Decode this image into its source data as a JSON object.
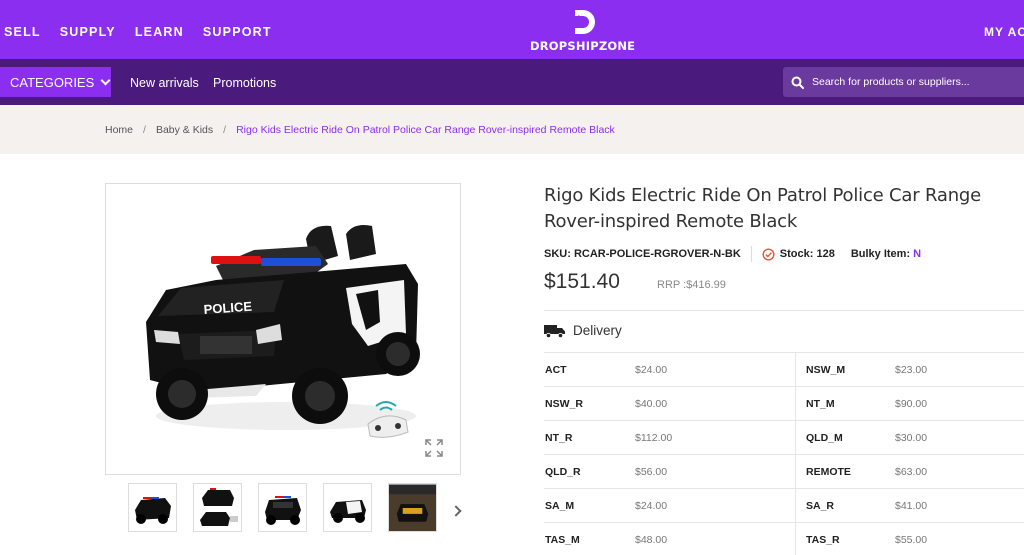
{
  "topnav": {
    "items": [
      "SELL",
      "SUPPLY",
      "LEARN",
      "SUPPORT"
    ],
    "logo_text": "DROPSHIPZONE",
    "account": "MY AC"
  },
  "navbar": {
    "categories": "CATEGORIES",
    "links": [
      "New arrivals",
      "Promotions"
    ],
    "search_placeholder": "Search for products or suppliers..."
  },
  "breadcrumb": {
    "items": [
      "Home",
      "Baby & Kids",
      "Rigo Kids Electric Ride On Patrol Police Car Range Rover-inspired Remote Black"
    ],
    "separator": "/"
  },
  "product": {
    "title": "Rigo Kids Electric Ride On Patrol Police Car Range Rover-inspired Remote Black",
    "sku_label": "SKU: RCAR-POLICE-RGROVER-N-BK",
    "stock_label": "Stock: 128",
    "bulky_label": "Bulky Item:",
    "bulky_value": "N",
    "price": "$151.40",
    "rrp": "RRP :$416.99",
    "car_text": "POLICE"
  },
  "delivery": {
    "heading": "Delivery",
    "rates": [
      {
        "left_region": "ACT",
        "left_price": "$24.00",
        "right_region": "NSW_M",
        "right_price": "$23.00"
      },
      {
        "left_region": "NSW_R",
        "left_price": "$40.00",
        "right_region": "NT_M",
        "right_price": "$90.00"
      },
      {
        "left_region": "NT_R",
        "left_price": "$112.00",
        "right_region": "QLD_M",
        "right_price": "$30.00"
      },
      {
        "left_region": "QLD_R",
        "left_price": "$56.00",
        "right_region": "REMOTE",
        "right_price": "$63.00"
      },
      {
        "left_region": "SA_M",
        "left_price": "$24.00",
        "right_region": "SA_R",
        "right_price": "$41.00"
      },
      {
        "left_region": "TAS_M",
        "left_price": "$48.00",
        "right_region": "TAS_R",
        "right_price": "$55.00"
      }
    ]
  },
  "colors": {
    "brand_purple": "#8c2ef0",
    "nav_dark_purple": "#4b1a7d",
    "breadcrumb_bg": "#f5f1ee"
  }
}
